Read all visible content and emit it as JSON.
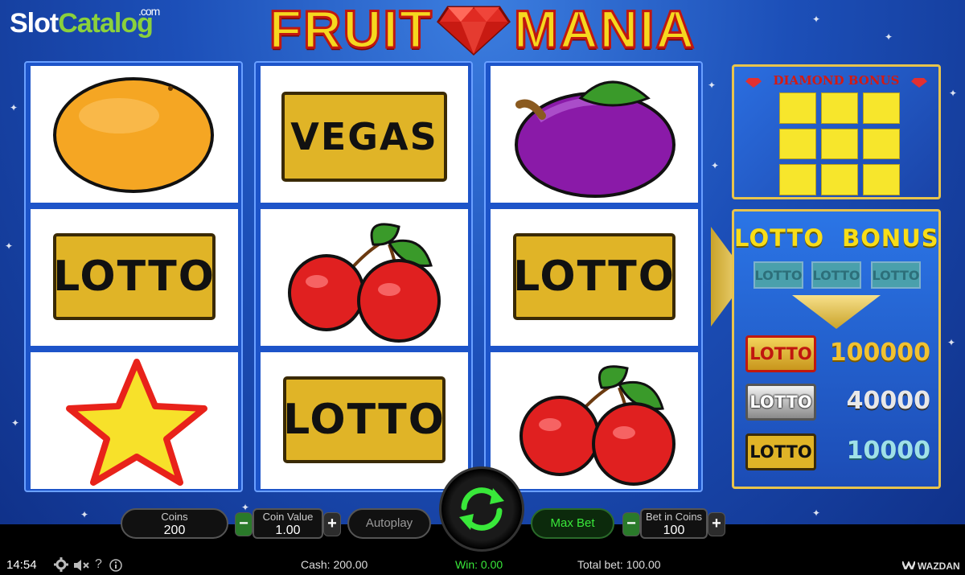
{
  "watermark": {
    "slot": "Slot",
    "catalog": "Catalog",
    "domain": ".com"
  },
  "game_title": {
    "left": "FRUIT",
    "right": "MANIA"
  },
  "reels": [
    [
      "orange",
      "vegas",
      "plum"
    ],
    [
      "lotto",
      "cherries",
      "lotto"
    ],
    [
      "star",
      "lotto",
      "cherries"
    ]
  ],
  "plate_labels": {
    "vegas": "VEGAS",
    "lotto": "LOTTO"
  },
  "diamond_bonus": {
    "title": "DIAMOND BONUS"
  },
  "lotto_bonus": {
    "title": "LOTTO  BONUS",
    "slots": [
      "LOTTO",
      "LOTTO",
      "LOTTO"
    ],
    "prizes": [
      {
        "label": "LOTTO",
        "value": "100000",
        "tier": "gold"
      },
      {
        "label": "LOTTO",
        "value": "40000",
        "tier": "silver"
      },
      {
        "label": "LOTTO",
        "value": "10000",
        "tier": "bronze"
      }
    ]
  },
  "controls": {
    "coins_label": "Coins",
    "coins_value": "200",
    "coin_value_label": "Coin Value",
    "coin_value": "1.00",
    "autoplay": "Autoplay",
    "max_bet": "Max Bet",
    "bet_in_coins_label": "Bet in Coins",
    "bet_in_coins": "100",
    "minus": "−",
    "plus": "+"
  },
  "status_bar": {
    "time": "14:54",
    "cash": "Cash: 200.00",
    "win": "Win: 0.00",
    "total_bet": "Total bet: 100.00",
    "provider": "WAZDAN",
    "help": "?"
  },
  "colors": {
    "win_green": "#39e83a",
    "gold": "#f8dd18",
    "reel_blue": "#1d54c9"
  }
}
